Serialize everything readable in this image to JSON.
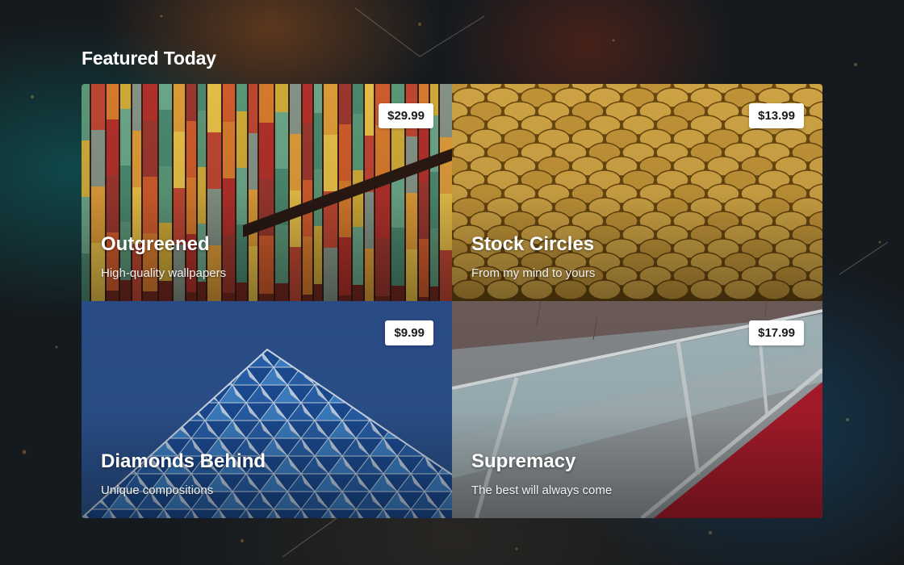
{
  "page": {
    "title": "Featured Today"
  },
  "cards": [
    {
      "title": "Outgreened",
      "subtitle": "High-quality wallpapers",
      "price": "$29.99",
      "image_icon": "colorful-stacked-panels-image"
    },
    {
      "title": "Stock Circles",
      "subtitle": "From my mind to yours",
      "price": "$13.99",
      "image_icon": "golden-scale-tiles-image"
    },
    {
      "title": "Diamonds Behind",
      "subtitle": "Unique compositions",
      "price": "$9.99",
      "image_icon": "blue-triangular-facade-image"
    },
    {
      "title": "Supremacy",
      "subtitle": "The best will always come",
      "price": "$17.99",
      "image_icon": "glass-railing-architecture-image"
    }
  ],
  "colors": {
    "background": "#151a1e",
    "price_badge": "#ffffff",
    "text": "#ffffff"
  }
}
